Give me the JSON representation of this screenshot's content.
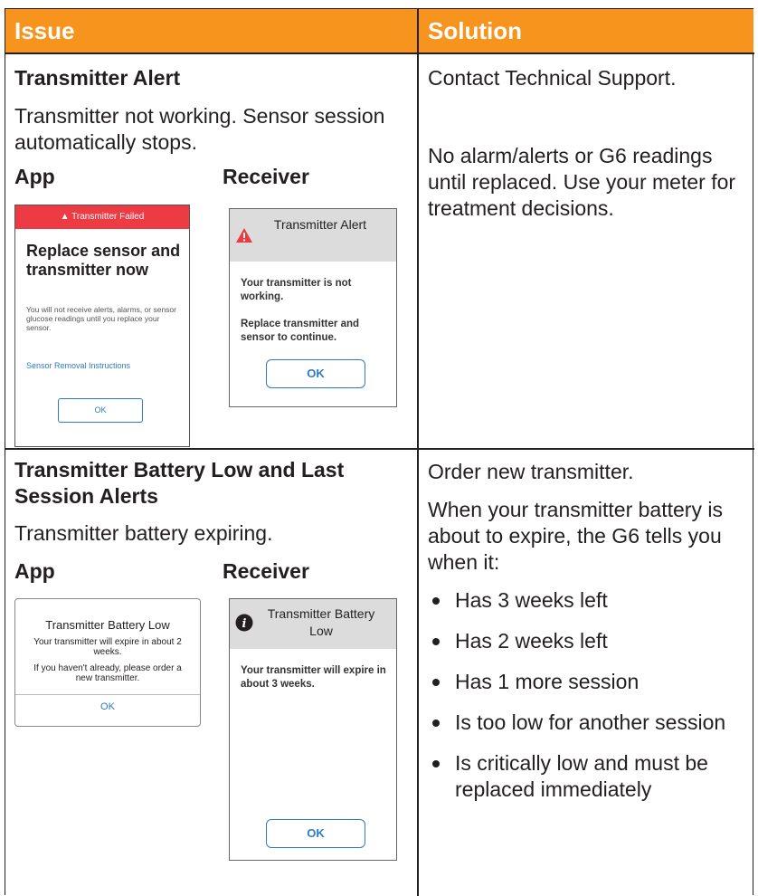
{
  "header": {
    "issue": "Issue",
    "solution": "Solution"
  },
  "row1": {
    "title": "Transmitter Alert",
    "desc": "Transmitter not working. Sensor session automatically stops.",
    "app_label": "App",
    "receiver_label": "Receiver",
    "app_screen": {
      "banner": "Transmitter Failed",
      "heading": "Replace sensor and transmitter now",
      "body": "You will not receive alerts, alarms, or sensor glucose readings until you replace your sensor.",
      "link": "Sensor Removal Instructions",
      "ok": "OK"
    },
    "receiver_screen": {
      "title": "Transmitter Alert",
      "line1": "Your transmitter is not working.",
      "line2": "Replace transmitter and sensor to continue.",
      "ok": "OK"
    },
    "solution_1": "Contact Technical Support.",
    "solution_2": "No alarm/alerts or G6 readings until replaced. Use your meter for treatment decisions."
  },
  "row2": {
    "title": "Transmitter Battery Low and Last Session Alerts",
    "desc": "Transmitter battery expiring.",
    "app_label": "App",
    "receiver_label": "Receiver",
    "app_screen": {
      "heading": "Transmitter Battery Low",
      "line1": "Your transmitter will expire in about 2 weeks.",
      "line2": "If you haven't already, please order a new transmitter.",
      "ok": "OK"
    },
    "receiver_screen": {
      "title": "Transmitter Battery Low",
      "line1": "Your transmitter will expire in about 3 weeks.",
      "ok": "OK"
    },
    "solution_1": "Order new transmitter.",
    "solution_2": "When your transmitter battery is about to expire, the G6 tells you when it:",
    "bullets": [
      "Has 3 weeks left",
      "Has 2 weeks left",
      "Has 1 more session",
      "Is too low for another session",
      "Is critically low and must be replaced immediately"
    ]
  },
  "colors": {
    "header_bg": "#f7941d",
    "alert_red": "#ee3a43",
    "link_blue": "#2e7bc4",
    "receiver_header": "#dcdcdc"
  },
  "icons": {
    "warning": "warning-triangle-icon",
    "info": "info-circle-icon"
  }
}
